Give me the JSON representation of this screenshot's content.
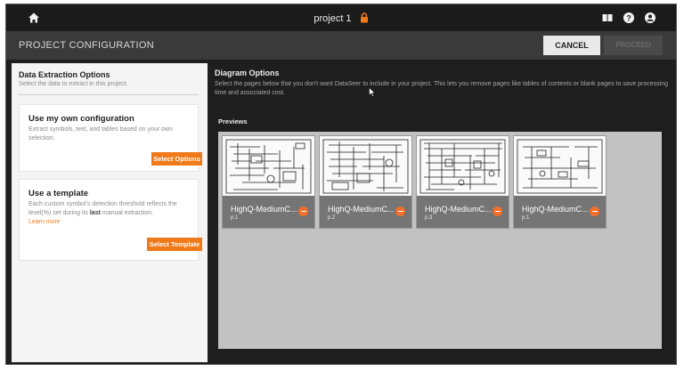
{
  "topbar": {
    "project_name": "project 1",
    "icons": [
      "home-icon",
      "lock-icon",
      "book-icon",
      "help-icon",
      "account-icon"
    ]
  },
  "header": {
    "title": "PROJECT CONFIGURATION",
    "cancel_label": "CANCEL",
    "proceed_label": "PROCEED"
  },
  "left": {
    "title": "Data Extraction Options",
    "subtitle": "Select the data to extract in this project.",
    "own_config": {
      "title": "Use my own configuration",
      "description": "Extract symbols, text, and tables based on your own selection.",
      "button": "Select Options"
    },
    "template": {
      "title": "Use a template",
      "description_pre": "Each custom symbol's detection threshold reflects the level(%) set during its ",
      "description_bold": "last",
      "description_post": " manual extraction.",
      "learn_more": "Learn more",
      "button": "Select Template"
    }
  },
  "diagram": {
    "title": "Diagram Options",
    "description": "Select the pages below that you don't want DataSeer to include in your project. This lets you remove pages like tables of contents or blank pages to save processing time and associated cost.",
    "previews_label": "Previews",
    "previews": [
      {
        "name": "HighQ-MediumC...",
        "page": "p.1"
      },
      {
        "name": "HighQ-MediumC...",
        "page": "p.2"
      },
      {
        "name": "HighQ-MediumC...",
        "page": "p.3"
      },
      {
        "name": "HighQ-MediumC...",
        "page": "p.1"
      }
    ]
  },
  "colors": {
    "accent": "#f07a1a",
    "topbar": "#1b1b1b",
    "header": "#3a3a3a",
    "gallery": "#c2c2c2"
  }
}
